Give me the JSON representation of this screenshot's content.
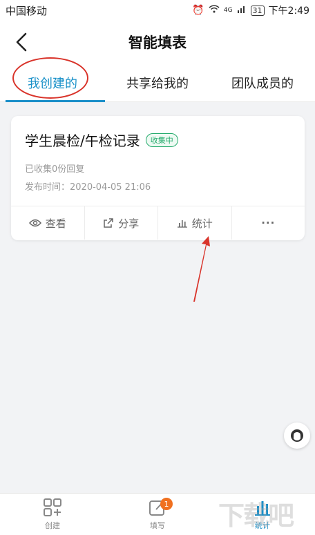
{
  "statusbar": {
    "carrier": "中国移动",
    "network": "4G",
    "battery": "31",
    "time": "下午2:49"
  },
  "header": {
    "title": "智能填表",
    "back_icon": "chevron-left-icon"
  },
  "tabs": [
    {
      "label": "我创建的",
      "active": true
    },
    {
      "label": "共享给我的",
      "active": false
    },
    {
      "label": "团队成员的",
      "active": false
    }
  ],
  "card": {
    "title": "学生晨检/午检记录",
    "badge": "收集中",
    "collected": "已收集0份回复",
    "publish_time": "发布时间：2020-04-05 21:06",
    "actions": [
      {
        "label": "查看",
        "icon": "eye-icon"
      },
      {
        "label": "分享",
        "icon": "share-icon"
      },
      {
        "label": "统计",
        "icon": "bar-chart-icon"
      },
      {
        "label": "···",
        "icon": "more-icon"
      }
    ]
  },
  "bottomnav": [
    {
      "label": "创建",
      "icon": "grid-plus-icon",
      "active": false
    },
    {
      "label": "填写",
      "icon": "edit-icon",
      "badge": "1",
      "active": false
    },
    {
      "label": "统计",
      "icon": "stats-icon",
      "active": true
    }
  ],
  "watermark": "下载吧",
  "colors": {
    "accent": "#1a8fc9",
    "badge_green": "#22aa6b",
    "annotation_red": "#d9342b",
    "notif_orange": "#f0701f"
  }
}
